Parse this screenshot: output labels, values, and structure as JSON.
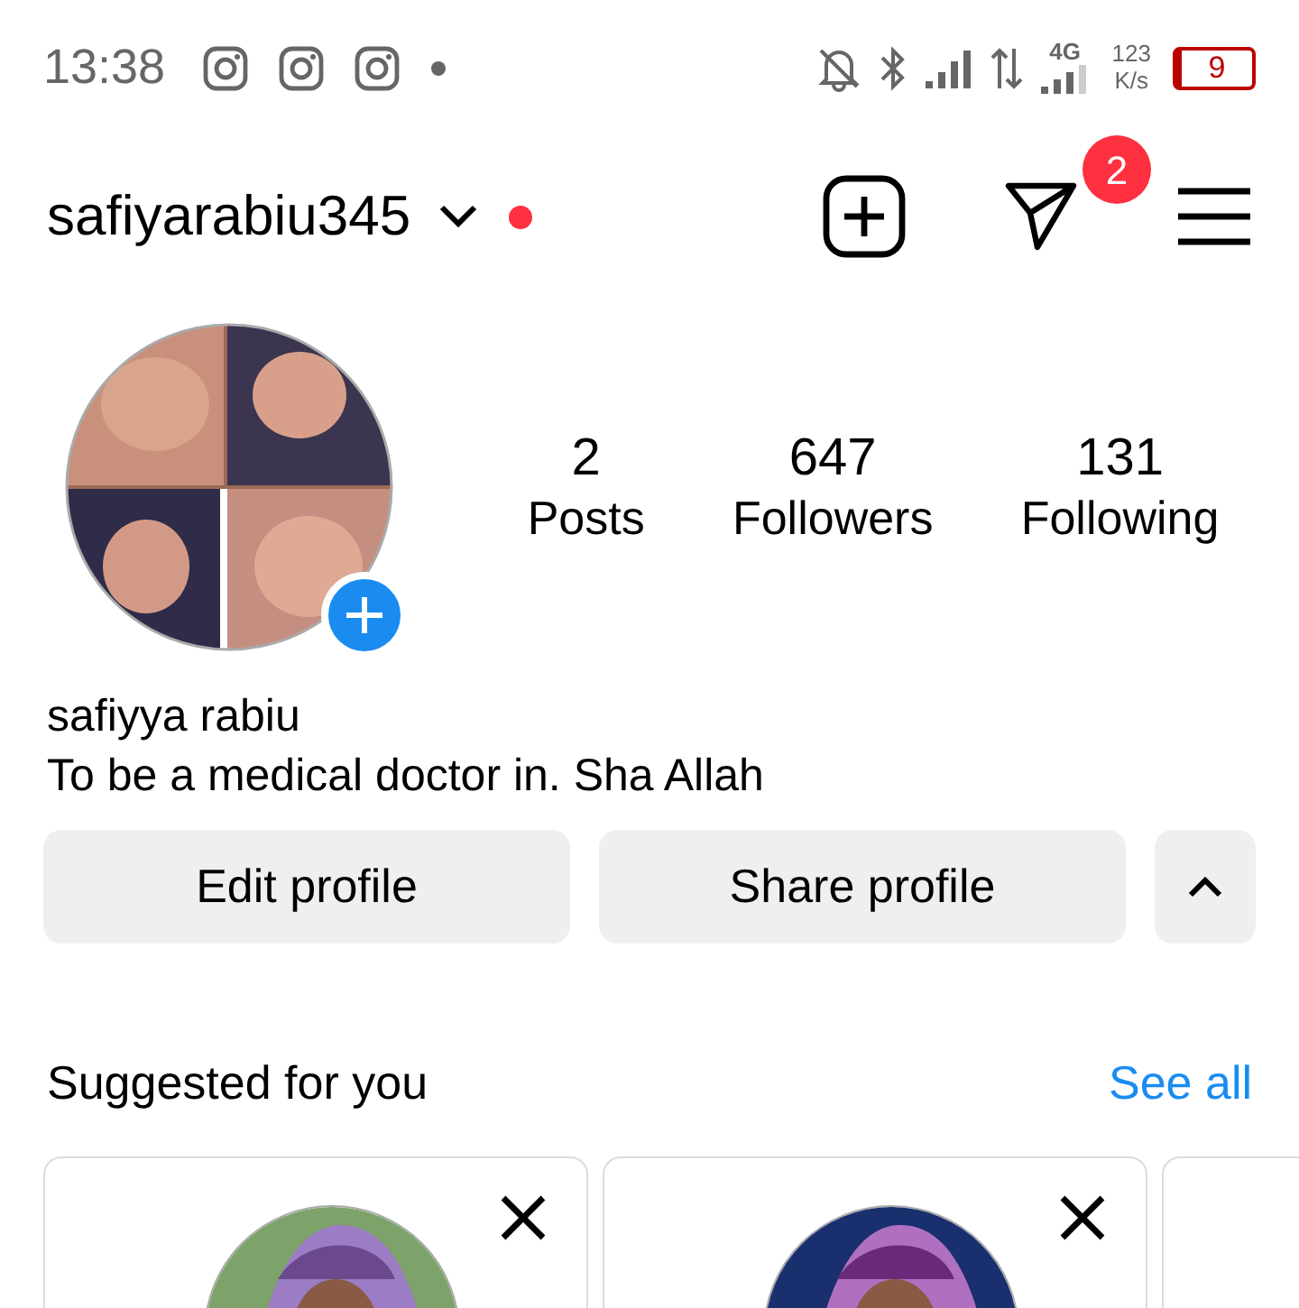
{
  "status_bar": {
    "time": "13:38",
    "app_notifications": [
      {
        "kind": "camera"
      },
      {
        "kind": "camera"
      },
      {
        "kind": "camera"
      }
    ],
    "network": "4G",
    "speed": "123",
    "speed_unit": "K/s",
    "battery": "9",
    "battery_low": true
  },
  "header": {
    "username": "safiyarabiu345",
    "new_activity": true,
    "messages_badge": "2"
  },
  "profile": {
    "stats": [
      {
        "value": "2",
        "label": "Posts"
      },
      {
        "value": "647",
        "label": "Followers"
      },
      {
        "value": "131",
        "label": "Following"
      }
    ],
    "name": "safiyya rabiu",
    "bio": "To be a medical doctor in. Sha Allah",
    "buttons": [
      "Edit profile",
      "Share profile"
    ],
    "suggestions_expanded": true
  },
  "suggested": {
    "title": "Suggested for you",
    "link": "See all",
    "cards": [
      {
        "kind": "picture"
      },
      {
        "kind": "picture"
      },
      {
        "kind": "empty"
      }
    ]
  }
}
